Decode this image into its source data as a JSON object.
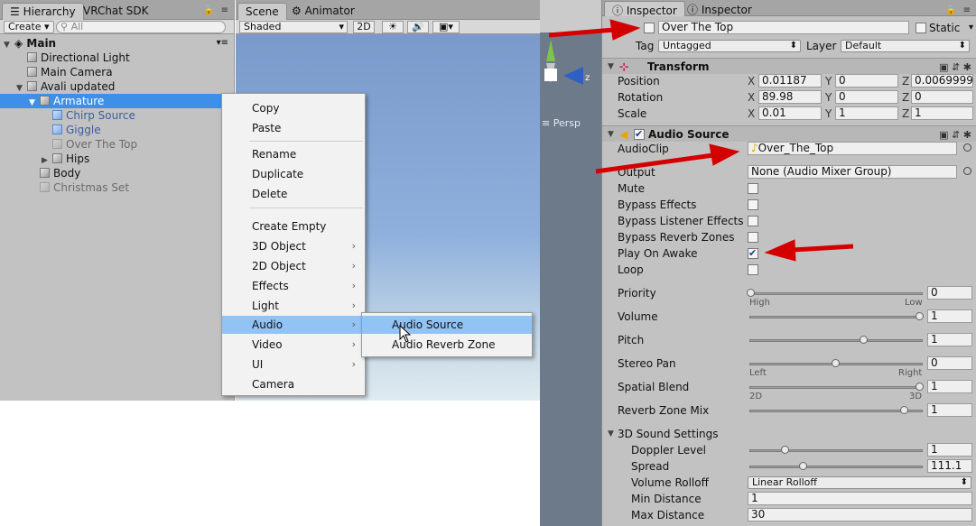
{
  "hierarchy": {
    "tabs": [
      "Hierarchy",
      "VRChat SDK"
    ],
    "create_label": "Create",
    "search_placeholder": "All",
    "scene_name": "Main",
    "items": [
      {
        "label": "Directional Light"
      },
      {
        "label": "Main Camera"
      },
      {
        "label": "Avali updated"
      },
      {
        "label": "Armature"
      },
      {
        "label": "Chirp Source"
      },
      {
        "label": "Giggle"
      },
      {
        "label": "Over The Top"
      },
      {
        "label": "Hips"
      },
      {
        "label": "Body"
      },
      {
        "label": "Christmas Set"
      }
    ]
  },
  "scene": {
    "tabs": [
      "Scene",
      "Animator"
    ],
    "shading": "Shaded",
    "mode_2d": "2D",
    "persp_label": "Persp"
  },
  "context_menu": {
    "items": [
      "Copy",
      "Paste",
      "Rename",
      "Duplicate",
      "Delete",
      "Create Empty",
      "3D Object",
      "2D Object",
      "Effects",
      "Light",
      "Audio",
      "Video",
      "UI",
      "Camera"
    ],
    "submenu": [
      "Audio Source",
      "Audio Reverb Zone"
    ]
  },
  "inspector": {
    "tabs": [
      "Inspector",
      "Inspector"
    ],
    "object_name": "Over The Top",
    "static_label": "Static",
    "tag_label": "Tag",
    "tag_value": "Untagged",
    "layer_label": "Layer",
    "layer_value": "Default",
    "transform": {
      "title": "Transform",
      "position_label": "Position",
      "rotation_label": "Rotation",
      "scale_label": "Scale",
      "position": [
        "0.01187",
        "0",
        "0.00699999"
      ],
      "rotation": [
        "89.98",
        "0",
        "0"
      ],
      "scale": [
        "0.01",
        "1",
        "1"
      ],
      "axes": [
        "X",
        "Y",
        "Z"
      ]
    },
    "audio_source": {
      "title": "Audio Source",
      "audioclip_label": "AudioClip",
      "audioclip_value": "Over_The_Top",
      "output_label": "Output",
      "output_value": "None (Audio Mixer Group)",
      "mute_label": "Mute",
      "bypass_effects_label": "Bypass Effects",
      "bypass_listener_label": "Bypass Listener Effects",
      "bypass_reverb_label": "Bypass Reverb Zones",
      "play_on_awake_label": "Play On Awake",
      "loop_label": "Loop",
      "priority_label": "Priority",
      "priority_value": "0",
      "priority_min": "High",
      "priority_max": "Low",
      "volume_label": "Volume",
      "volume_value": "1",
      "pitch_label": "Pitch",
      "pitch_value": "1",
      "stereo_label": "Stereo Pan",
      "stereo_value": "0",
      "stereo_min": "Left",
      "stereo_max": "Right",
      "spatial_label": "Spatial Blend",
      "spatial_value": "1",
      "spatial_min": "2D",
      "spatial_max": "3D",
      "reverb_mix_label": "Reverb Zone Mix",
      "reverb_mix_value": "1",
      "sound3d_label": "3D Sound Settings",
      "doppler_label": "Doppler Level",
      "doppler_value": "1",
      "spread_label": "Spread",
      "spread_value": "111.1",
      "rolloff_label": "Volume Rolloff",
      "rolloff_value": "Linear Rolloff",
      "min_dist_label": "Min Distance",
      "min_dist_value": "1",
      "max_dist_label": "Max Distance",
      "max_dist_value": "30"
    }
  }
}
